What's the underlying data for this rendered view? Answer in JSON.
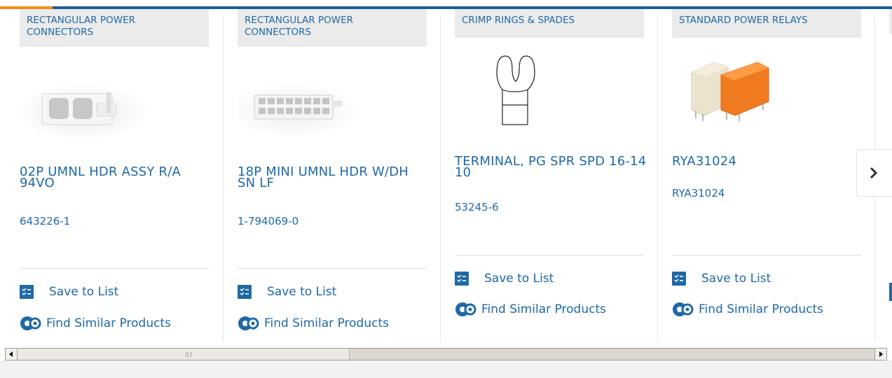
{
  "colors": {
    "link": "#1f69a6",
    "brand_bar": "#1f5f92",
    "accent": "#f28d1c"
  },
  "products": [
    {
      "category": "RECTANGULAR POWER CONNECTORS",
      "title": "02P UMNL HDR ASSY R/A 94VO",
      "part_number": "643226-1"
    },
    {
      "category": "RECTANGULAR POWER CONNECTORS",
      "title": "18P MINI UMNL HDR W/DH SN LF",
      "part_number": "1-794069-0"
    },
    {
      "category": "CRIMP RINGS & SPADES",
      "title": "TERMINAL, PG SPR SPD 16-14 10",
      "part_number": "53245-6"
    },
    {
      "category": "STANDARD POWER RELAYS",
      "title": "RYA31024",
      "part_number": "RYA31024"
    }
  ],
  "actions": {
    "save": "Save to List",
    "similar": "Find Similar Products"
  },
  "icons": {
    "next": "chevron-right-icon",
    "save": "checklist-icon",
    "similar": "gear-icon"
  }
}
